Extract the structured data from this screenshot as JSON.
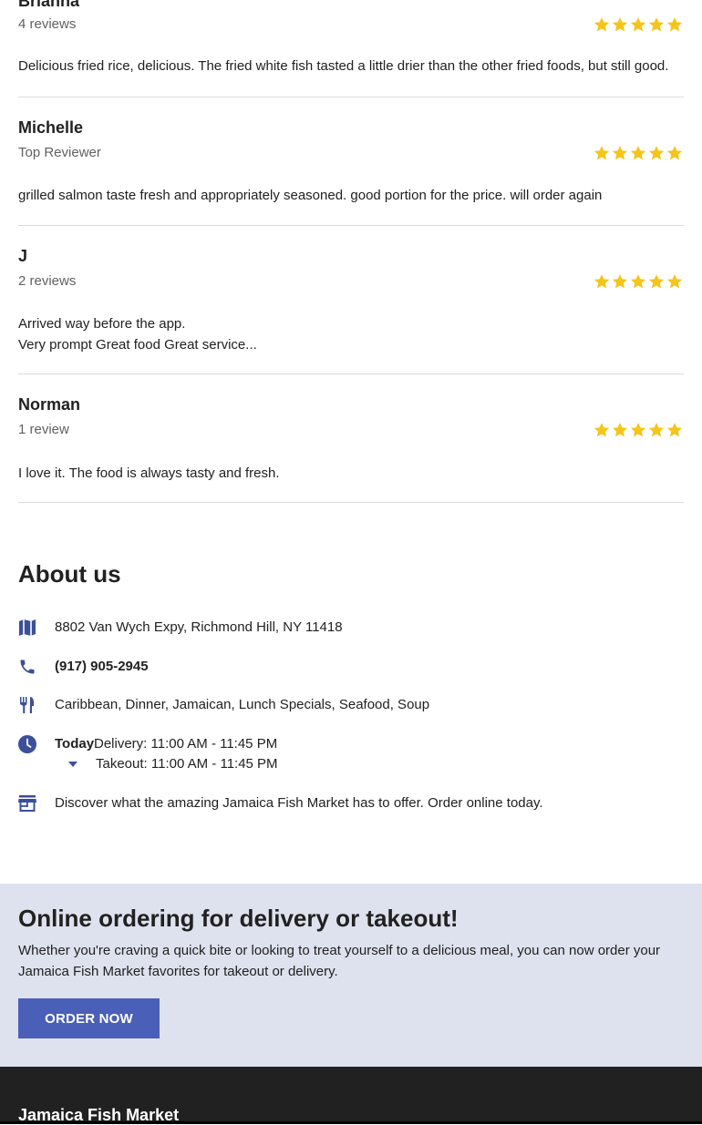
{
  "reviews": [
    {
      "name": "Brianna",
      "subtitle": "4 reviews",
      "rating": 5,
      "text": "Delicious fried rice, delicious. The fried white fish tasted a little drier than the other fried foods, but still good."
    },
    {
      "name": "Michelle",
      "subtitle": "Top Reviewer",
      "rating": 5,
      "text": "grilled salmon taste fresh and appropriately seasoned. good portion for the price. will order again"
    },
    {
      "name": "J",
      "subtitle": "2 reviews",
      "rating": 5,
      "text": "Arrived way before the app.\nVery prompt Great food Great service..."
    },
    {
      "name": "Norman",
      "subtitle": "1 review",
      "rating": 5,
      "text": "I love it. The food is always tasty and fresh."
    }
  ],
  "star_color": "#f5c518",
  "about": {
    "title": "About us",
    "address": "8802 Van Wych Expy, Richmond Hill, NY 11418",
    "phone": "(917) 905-2945",
    "cuisines": "Caribbean, Dinner, Jamaican, Lunch Specials, Seafood, Soup",
    "hours": {
      "today_label": "Today",
      "delivery": "Delivery: 11:00 AM - 11:45 PM",
      "takeout": "Takeout: 11:00 AM - 11:45 PM"
    },
    "description": "Discover what the amazing Jamaica Fish Market has to offer. Order online today.",
    "icons": [
      "map-icon",
      "phone-icon",
      "utensils-icon",
      "clock-icon",
      "storefront-icon"
    ],
    "icon_color": "#3b4f9a"
  },
  "promo": {
    "title": "Online ordering for delivery or takeout!",
    "text": "Whether you're craving a quick bite or looking to treat yourself to a delicious meal, you can now order your Jamaica Fish Market favorites for takeout or delivery.",
    "button_label": "ORDER NOW",
    "background": "#dee2ee",
    "button_color": "#4a5fb8"
  },
  "footer": {
    "restaurant_name": "Jamaica Fish Market",
    "background": "#212121"
  }
}
